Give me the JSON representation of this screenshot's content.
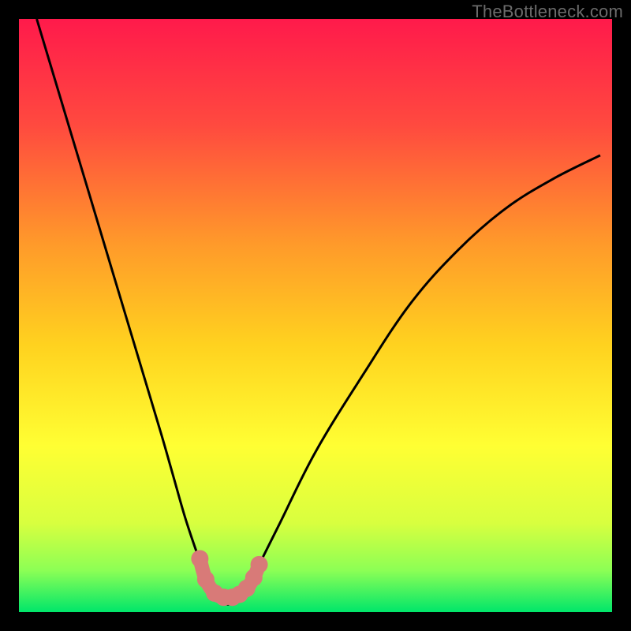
{
  "watermark": "TheBottleneck.com",
  "chart_data": {
    "type": "line",
    "title": "",
    "xlabel": "",
    "ylabel": "",
    "xlim": [
      0,
      100
    ],
    "ylim": [
      0,
      100
    ],
    "gradient_stops": [
      {
        "offset": 0.0,
        "color": "#ff1a4b"
      },
      {
        "offset": 0.18,
        "color": "#ff4a3f"
      },
      {
        "offset": 0.38,
        "color": "#ff9a2a"
      },
      {
        "offset": 0.55,
        "color": "#ffd21f"
      },
      {
        "offset": 0.72,
        "color": "#ffff33"
      },
      {
        "offset": 0.85,
        "color": "#d8ff3f"
      },
      {
        "offset": 0.93,
        "color": "#8cff55"
      },
      {
        "offset": 1.0,
        "color": "#00e66a"
      }
    ],
    "series": [
      {
        "name": "bottleneck-curve",
        "x": [
          3,
          6,
          9,
          12,
          15,
          18,
          21,
          24,
          26,
          28,
          30,
          31.5,
          33,
          34.5,
          36,
          38,
          40,
          44,
          50,
          58,
          66,
          74,
          82,
          90,
          98
        ],
        "y": [
          100,
          90,
          80,
          70,
          60,
          50,
          40,
          30,
          23,
          16,
          10,
          6,
          3,
          1.5,
          1.5,
          3,
          7,
          15,
          27,
          40,
          52,
          61,
          68,
          73,
          77
        ]
      }
    ],
    "highlight": {
      "name": "minimum-band",
      "color": "#d87a78",
      "points": [
        {
          "x": 30.5,
          "y": 9.0
        },
        {
          "x": 31.5,
          "y": 5.5
        },
        {
          "x": 33.0,
          "y": 3.2
        },
        {
          "x": 34.5,
          "y": 2.5
        },
        {
          "x": 36.0,
          "y": 2.5
        },
        {
          "x": 37.2,
          "y": 3.0
        },
        {
          "x": 38.4,
          "y": 4.0
        },
        {
          "x": 39.6,
          "y": 5.8
        },
        {
          "x": 40.5,
          "y": 8.0
        }
      ]
    }
  }
}
